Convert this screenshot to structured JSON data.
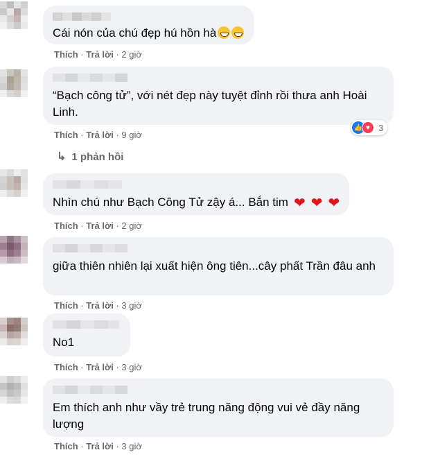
{
  "comments": [
    {
      "text": "Cái nón của chú đẹp hú hồn hà",
      "like": "Thích",
      "reply": "Trả lời",
      "time": "2 giờ",
      "avatar": [
        "#d9d9d9",
        "#bdbdbd",
        "#e3e3e3",
        "#cfcfcf",
        "#c9c9c9",
        "#e6e6e6",
        "#b8a8a8",
        "#dcdcdc",
        "#e8e8e8",
        "#d6cfcf",
        "#c5b6b6",
        "#eeeeee",
        "#f0f0f0",
        "#dedede",
        "#d0c8c8",
        "#e9e9e9"
      ]
    },
    {
      "text": "“Bạch công tử”, với nét đẹp này tuyệt đỉnh rồi thưa anh Hoài Linh.",
      "like": "Thích",
      "reply": "Trả lời",
      "time": "9 giờ",
      "reaction_count": "3",
      "avatar": [
        "#e2e2e2",
        "#c2c8bc",
        "#b9b4a8",
        "#e4e4e4",
        "#d8d8d8",
        "#a9a496",
        "#bfb6a8",
        "#dcdcdc",
        "#cfcfcf",
        "#b0a89c",
        "#c3baaf",
        "#e1e1e1",
        "#efefef",
        "#d7d7d7",
        "#cfcfcf",
        "#f0f0f0"
      ]
    },
    {
      "text": "Nhìn chú như Bạch Công Tử zậy á... Bắn tim",
      "like": "Thích",
      "reply": "Trả lời",
      "time": "2 giờ",
      "avatar": [
        "#e6e6e6",
        "#dadada",
        "#ededed",
        "#e2e2e2",
        "#d4d4d4",
        "#c7c0bc",
        "#b6aaa4",
        "#e0e0e0",
        "#cfcfcf",
        "#c9bfb8",
        "#c0b2ac",
        "#e6e6e6",
        "#eeeeee",
        "#dcdcdc",
        "#d2d2d2",
        "#f0f0f0"
      ]
    },
    {
      "text": "giữa thiên nhiên lại xuất hiện ông tiên...cây phất Trần đâu anh",
      "like": "Thích",
      "reply": "Trả lời",
      "time": "3 giờ",
      "avatar": [
        "#b6a3ad",
        "#8e7480",
        "#a891a0",
        "#cdbfc7",
        "#9c7f8e",
        "#7a5a6a",
        "#8f7080",
        "#c2b2bb",
        "#b49aa8",
        "#8d6e7e",
        "#9f8292",
        "#cbbcc4",
        "#d6cbd1",
        "#bfb0b8",
        "#c8bac2",
        "#e1d9dd"
      ]
    },
    {
      "text": "No1",
      "like": "Thích",
      "reply": "Trả lời",
      "time": "3 giờ",
      "avatar": [
        "#d8cfcf",
        "#a88f8c",
        "#9c827e",
        "#d6cccb",
        "#c6b6b3",
        "#8a6f6a",
        "#947a75",
        "#cfc4c2",
        "#d9d2d1",
        "#b8a6a3",
        "#bfaeab",
        "#e0dada",
        "#ece9e9",
        "#d9d1d0",
        "#dcd5d4",
        "#efeded"
      ]
    },
    {
      "text": "Em thích anh như vầy trẻ trung năng động vui vẻ đầy năng lượng",
      "like": "Thích",
      "reply": "Trả lời",
      "time": "3 giờ",
      "avatar": [
        "#e3e3e3",
        "#cfcfcf",
        "#d9d9d9",
        "#ececec",
        "#c4c4c4",
        "#b2b2b2",
        "#bdbdbd",
        "#e0e0e0",
        "#d5d5d5",
        "#c0c0c0",
        "#c9c9c9",
        "#e6e6e6",
        "#eeeeee",
        "#dcdcdc",
        "#d8d8d8",
        "#f2f2f2"
      ]
    }
  ],
  "replies_link": "1 phản hồi",
  "reaction_icons": [
    "like-icon",
    "love-icon"
  ],
  "colors": {
    "bubble": "#f0f2f5",
    "meta": "#65676b",
    "like": "#1877f2",
    "love": "#f33e58",
    "heart": "#e0161b"
  }
}
